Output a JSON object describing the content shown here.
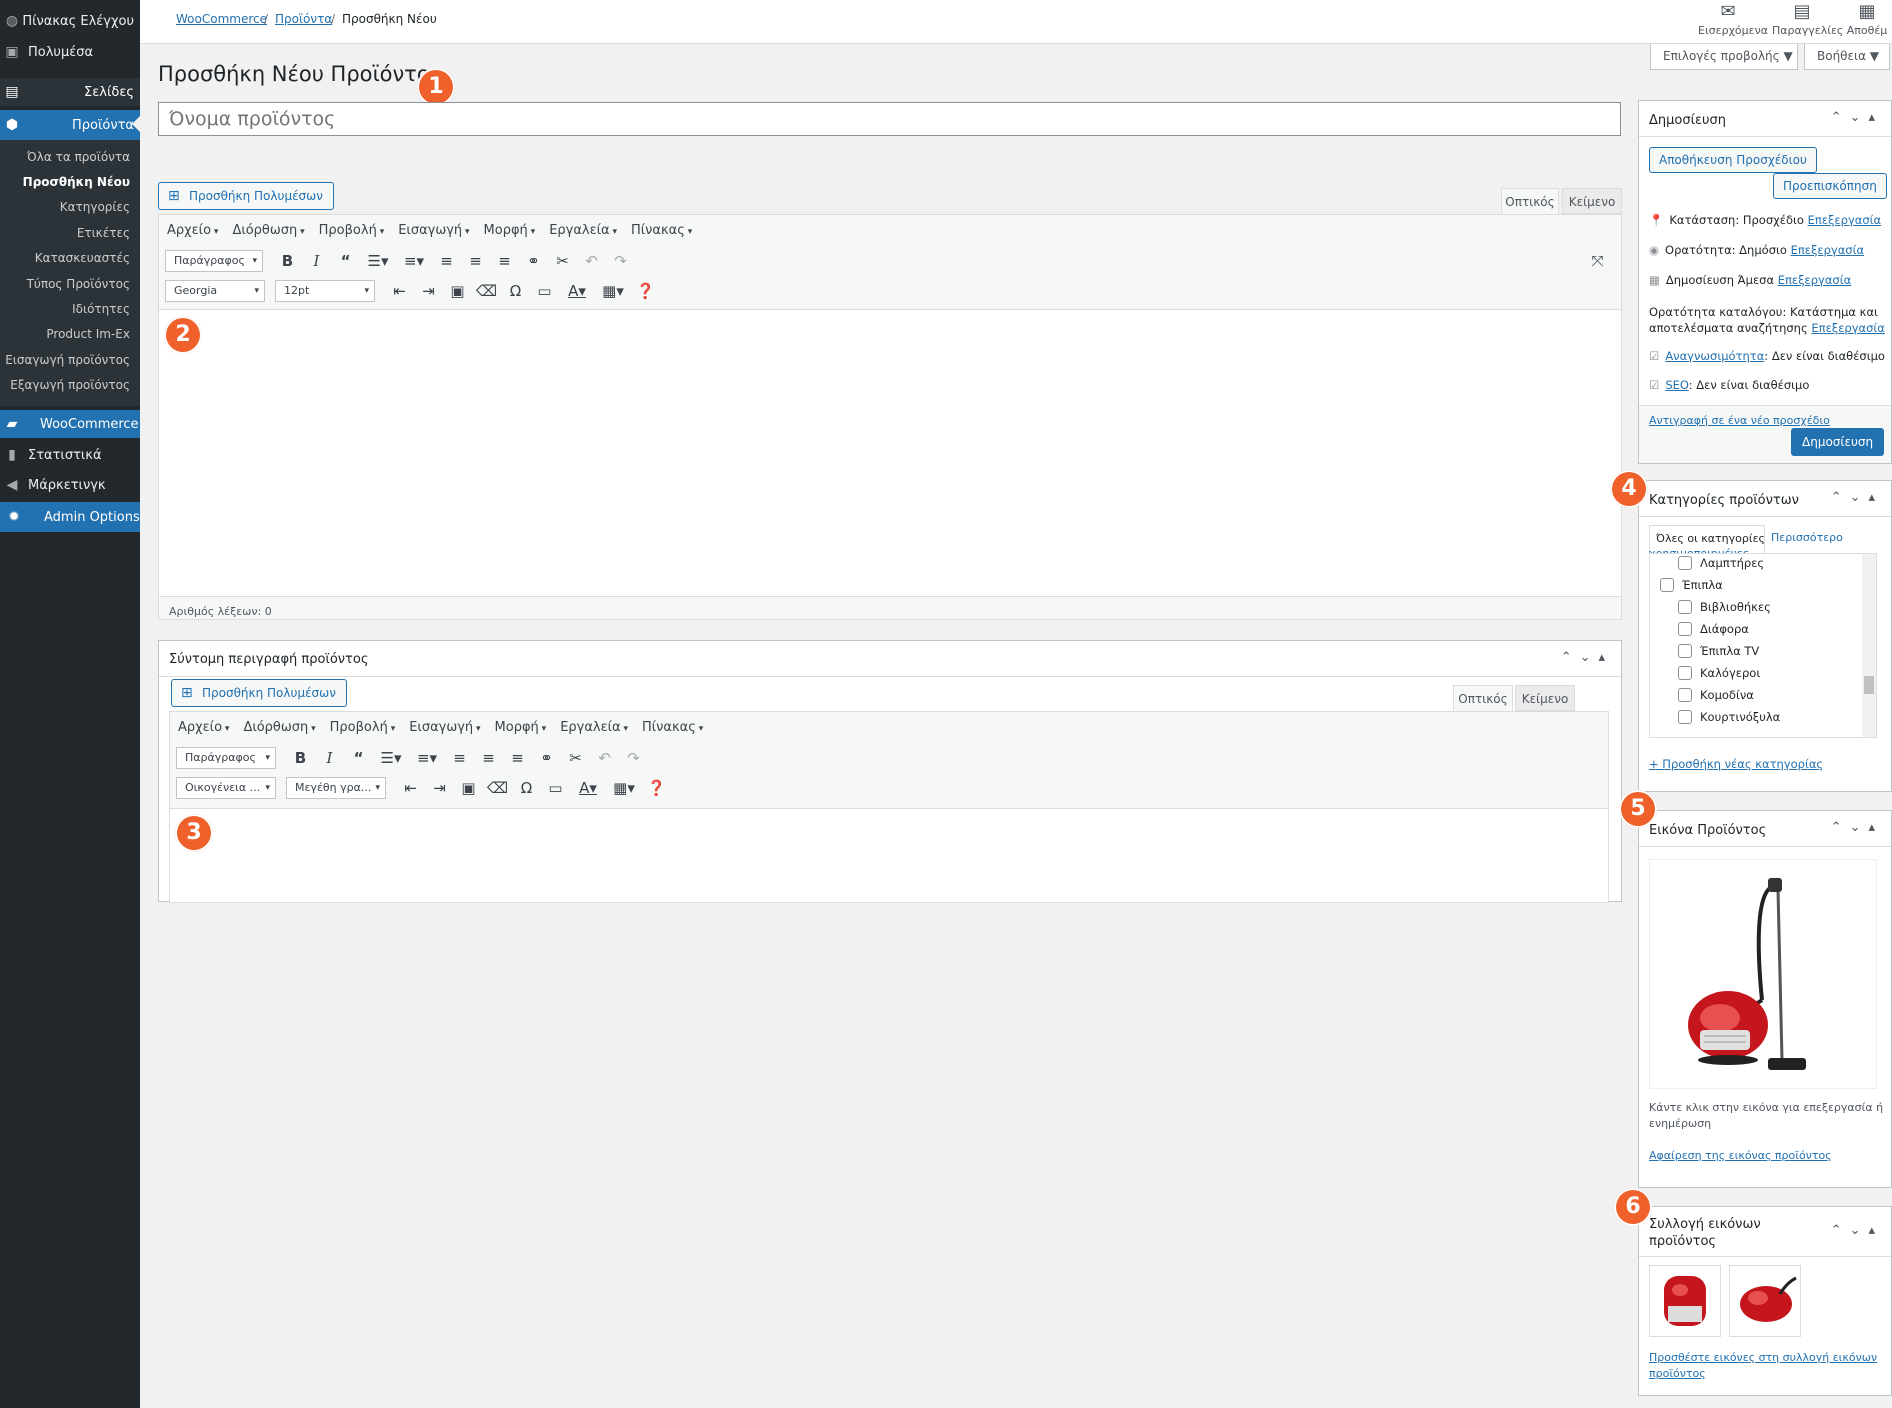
{
  "sidebar": {
    "items": [
      {
        "label": "Πίνακας Ελέγχου",
        "icon": "dashboard-icon",
        "glyph": "◍"
      },
      {
        "label": "Πολυμέσα",
        "icon": "media-icon",
        "glyph": "▣"
      },
      {
        "label": "Σελίδες",
        "icon": "pages-icon",
        "glyph": "▤"
      },
      {
        "label": "Προϊόντα",
        "icon": "products-icon",
        "glyph": "⬢"
      },
      {
        "label": "WooCommerce",
        "icon": "woocommerce-icon",
        "glyph": "▰"
      },
      {
        "label": "Στατιστικά",
        "icon": "stats-icon",
        "glyph": "▮"
      },
      {
        "label": "Μάρκετινγκ",
        "icon": "marketing-icon",
        "glyph": "◀"
      },
      {
        "label": "Admin Options",
        "icon": "gear-icon",
        "glyph": "✹"
      }
    ],
    "submenu": [
      "Όλα τα προϊόντα",
      "Προσθήκη Νέου",
      "Κατηγορίες",
      "Ετικέτες",
      "Κατασκευαστές",
      "Τύπος Προϊόντος",
      "Ιδιότητες",
      "Product Im-Ex",
      "Εισαγωγή προϊόντος",
      "Εξαγωγή προϊόντος"
    ]
  },
  "breadcrumb": {
    "root": "WooCommerce",
    "section": "Προϊόντα",
    "current": "Προσθήκη Νέου",
    "sep": "/"
  },
  "top_icons": [
    {
      "label": "Εισερχόμενα",
      "glyph": "✉"
    },
    {
      "label": "Παραγγελίες",
      "glyph": "▤"
    },
    {
      "label": "Αποθέμ",
      "glyph": "▦"
    }
  ],
  "screen_options": "Επιλογές προβολής ▼",
  "help": "Βοήθεια ▼",
  "page_title": "Προσθήκη Νέου Προϊόντος",
  "badges": [
    "1",
    "2",
    "3",
    "4",
    "5",
    "6"
  ],
  "product_name": {
    "placeholder": "Όνομα προϊόντος"
  },
  "editor": {
    "add_media": "Προσθήκη Πολυμέσων",
    "tab_visual": "Οπτικός",
    "tab_text": "Κείμενο",
    "menus": [
      "Αρχείο",
      "Διόρθωση",
      "Προβολή",
      "Εισαγωγή",
      "Μορφή",
      "Εργαλεία",
      "Πίνακας"
    ],
    "format": "Παράγραφος",
    "font_family": "Georgia",
    "font_size": "12pt",
    "word_count": "Αριθμός λέξεων: 0"
  },
  "short_description": {
    "title": "Σύντομη περιγραφή προϊόντος",
    "add_media": "Προσθήκη Πολυμέσων",
    "tab_visual": "Οπτικός",
    "tab_text": "Κείμενο",
    "menus": [
      "Αρχείο",
      "Διόρθωση",
      "Προβολή",
      "Εισαγωγή",
      "Μορφή",
      "Εργαλεία",
      "Πίνακας"
    ],
    "format": "Παράγραφος",
    "font_family": "Οικογένεια ...",
    "font_size": "Μεγέθη γρα..."
  },
  "publish": {
    "title": "Δημοσίευση",
    "save_draft": "Αποθήκευση Προσχέδιου",
    "preview": "Προεπισκόπηση",
    "status": "Κατάσταση: Προσχέδιο",
    "visibility": "Ορατότητα: Δημόσιο",
    "publish_time": "Δημοσίευση Άμεσα",
    "edit": "Επεξεργασία",
    "catalog_1": "Ορατότητα καταλόγου: Κατάστημα και",
    "catalog_2": "αποτελέσματα αναζήτησης",
    "readability_link": "Αναγνωσιμότητα",
    "readability_value": ": Δεν είναι διαθέσιμο",
    "seo_link": "SEO",
    "seo_value": ": Δεν είναι διαθέσιμο",
    "copy_draft": "Αντιγραφή σε ένα νέο προσχέδιο",
    "publish_button": "Δημοσίευση"
  },
  "categories": {
    "title": "Κατηγορίες προϊόντων",
    "tab_all": "Όλες οι κατηγορίες",
    "tab_popular_1": "Περισσότερο",
    "tab_popular_2": "χρησιμοποιημένες",
    "items": [
      {
        "label": "Λαμπτήρες",
        "level": 1
      },
      {
        "label": "Έπιπλα",
        "level": 0
      },
      {
        "label": "Βιβλιοθήκες",
        "level": 1
      },
      {
        "label": "Διάφορα",
        "level": 1
      },
      {
        "label": "Έπιπλα TV",
        "level": 1
      },
      {
        "label": "Καλόγεροι",
        "level": 1
      },
      {
        "label": "Κομοδίνα",
        "level": 1
      },
      {
        "label": "Κουρτινόξυλα",
        "level": 1
      }
    ],
    "add_new": "+ Προσθήκη νέας κατηγορίας"
  },
  "product_image": {
    "title": "Εικόνα Προϊόντος",
    "hint_1": "Κάντε κλικ στην εικόνα για επεξεργασία ή",
    "hint_2": "ενημέρωση",
    "remove": "Αφαίρεση της εικόνας προϊόντος"
  },
  "gallery": {
    "title_1": "Συλλογή εικόνων",
    "title_2": "προϊόντος",
    "add_1": "Προσθέστε εικόνες στη συλλογή εικόνων",
    "add_2": "προϊόντος"
  },
  "colors": {
    "accent": "#2271b1",
    "badge": "#f0602a",
    "sidebar": "#23282d",
    "product_red": "#c4161c"
  }
}
